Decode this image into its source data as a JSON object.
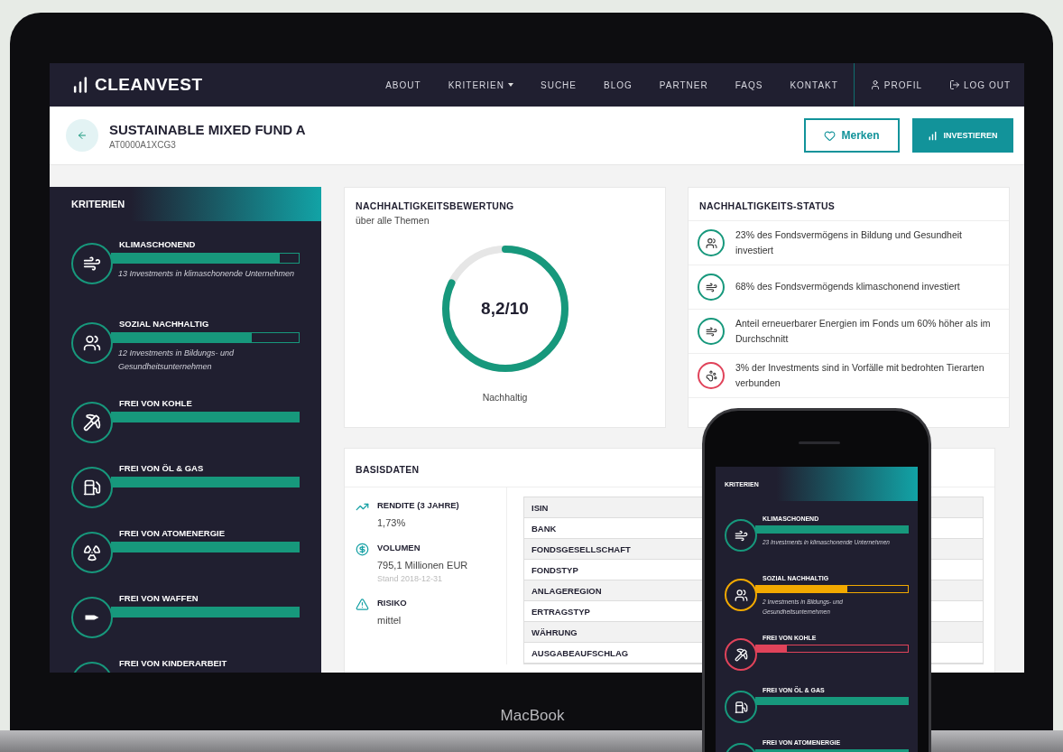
{
  "nav": {
    "logo": "CLEANVEST",
    "links": [
      {
        "label": "ABOUT",
        "dropdown": false
      },
      {
        "label": "KRITERIEN",
        "dropdown": true
      },
      {
        "label": "SUCHE",
        "dropdown": false
      },
      {
        "label": "BLOG",
        "dropdown": false
      },
      {
        "label": "PARTNER",
        "dropdown": false
      },
      {
        "label": "FAQS",
        "dropdown": false
      },
      {
        "label": "KONTAKT",
        "dropdown": false
      }
    ],
    "account": [
      {
        "kind": "profile",
        "label": "PROFIL"
      },
      {
        "kind": "logout",
        "label": "LOG OUT"
      }
    ]
  },
  "fund": {
    "title": "SUSTAINABLE MIXED FUND A",
    "isin": "AT0000A1XCG3",
    "buttons": [
      {
        "kind": "outline",
        "label": "Merken"
      },
      {
        "kind": "primary",
        "label": "INVESTIEREN"
      }
    ]
  },
  "criteria": {
    "title": "KRITERIEN",
    "items": [
      {
        "kind": "climate",
        "title": "KLIMASCHONEND",
        "level": 0.9,
        "text": "13 Investments in klimaschonende Unternehmen"
      },
      {
        "kind": "social",
        "title": "SOZIAL NACHHALTIG",
        "level": 0.75,
        "text": "12 Investments in Bildungs- und Gesundheitsunternehmen"
      },
      {
        "kind": "coal",
        "title": "FREI VON KOHLE",
        "level": 1
      },
      {
        "kind": "oil",
        "title": "FREI VON ÖL & GAS",
        "level": 1
      },
      {
        "kind": "nuclear",
        "title": "FREI VON ATOMENERGIE",
        "level": 1
      },
      {
        "kind": "weapons",
        "title": "FREI VON WAFFEN",
        "level": 1
      },
      {
        "kind": "labour",
        "title": "FREI VON KINDERARBEIT"
      }
    ]
  },
  "rating": {
    "title": "NACHHALTIGKEITSBEWERTUNG",
    "subtitle": "über alle Themen",
    "score": "8,2/10",
    "level": 0.82,
    "caption": "Nachhaltig"
  },
  "status": {
    "title": "NACHHALTIGKEITS-STATUS",
    "items": [
      {
        "kind": "social",
        "color": "#17987c",
        "text": "23% des Fondsvermögens in Bildung und Gesundheit investiert"
      },
      {
        "kind": "climate",
        "color": "#17987c",
        "text": "68% des Fondsvermögends klimaschonend investiert"
      },
      {
        "kind": "climate",
        "color": "#17987c",
        "text": "Anteil erneuerbarer Energien im Fonds um 60% höher als im Durchschnitt"
      },
      {
        "kind": "animals",
        "color": "#e0435a",
        "text": "3% der Investments sind in Vorfälle mit bedrohten Tierarten verbunden"
      }
    ]
  },
  "basisdaten": {
    "title": "BASISDATEN",
    "stats": [
      {
        "kind": "trend",
        "label": "RENDITE (3 JAHRE)",
        "value": "1,73%"
      },
      {
        "kind": "money",
        "label": "VOLUMEN",
        "value": "795,1 Millionen EUR",
        "note": "Stand 2018-12-31"
      },
      {
        "kind": "warning",
        "label": "RISIKO",
        "value": "mittel"
      }
    ],
    "table": [
      "ISIN",
      "BANK",
      "FONDSGESELLSCHAFT",
      "FONDSTYP",
      "ANLAGEREGION",
      "ERTRAGSTYP",
      "WÄHRUNG",
      "AUSGABEAUFSCHLAG"
    ]
  },
  "device": {
    "label": "MacBook"
  },
  "phone": {
    "title": "KRITERIEN",
    "items": [
      {
        "kind": "climate",
        "title": "KLIMASCHONEND",
        "level": 1,
        "color": "#17987c",
        "text": "23 Investments in klimaschonende Unternehmen"
      },
      {
        "kind": "social",
        "title": "SOZIAL NACHHALTIG",
        "level": 0.6,
        "color": "#f2a900",
        "text": "2 Investments in Bildungs- und Gesundheitsunternehmen"
      },
      {
        "kind": "coal",
        "title": "FREI VON KOHLE",
        "level": 0.2,
        "color": "#e0435a"
      },
      {
        "kind": "oil",
        "title": "FREI VON ÖL & GAS",
        "level": 1,
        "color": "#17987c"
      },
      {
        "kind": "nuclear",
        "title": "FREI VON ATOMENERGIE",
        "level": 1,
        "color": "#17987c"
      }
    ]
  }
}
